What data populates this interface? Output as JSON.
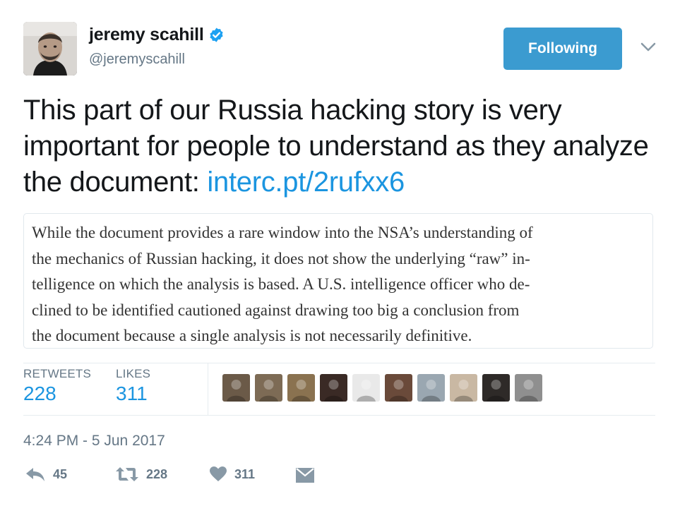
{
  "author": {
    "name": "jeremy scahill",
    "handle": "@jeremyscahill",
    "verified": true
  },
  "follow_button": {
    "label": "Following"
  },
  "tweet": {
    "text": "This part of our Russia hacking story is very important for people to understand as they analyze the document: ",
    "link": "interc.pt/2rufxx6"
  },
  "quote": {
    "text": "While the document provides a rare window into the NSA’s understanding of\nthe mechanics of Russian hacking, it does not show the underlying “raw” in-\ntelligence on which the analysis is based. A U.S. intelligence officer who de-\nclined to be identified cautioned against drawing too big a conclusion from\nthe document because a single analysis is not necessarily definitive."
  },
  "stats": {
    "retweets_label": "RETWEETS",
    "retweets_value": "228",
    "likes_label": "LIKES",
    "likes_value": "311"
  },
  "liker_avatars": [
    {
      "icon": "avatar-1",
      "color": "#6b5a48"
    },
    {
      "icon": "avatar-2",
      "color": "#7d6b55"
    },
    {
      "icon": "avatar-3",
      "color": "#8a7250"
    },
    {
      "icon": "avatar-4",
      "color": "#3a2a25"
    },
    {
      "icon": "avatar-5",
      "color": "#e9e9e9"
    },
    {
      "icon": "avatar-6",
      "color": "#6a4a3a"
    },
    {
      "icon": "avatar-7",
      "color": "#9aa7b1"
    },
    {
      "icon": "avatar-8",
      "color": "#c9b8a3"
    },
    {
      "icon": "avatar-9",
      "color": "#2e2a28"
    },
    {
      "icon": "avatar-10",
      "color": "#8f8f8f"
    }
  ],
  "timestamp": "4:24 PM - 5 Jun 2017",
  "actions": {
    "reply_count": "45",
    "retweet_count": "228",
    "like_count": "311"
  },
  "colors": {
    "accent": "#1b95e0",
    "follow_bg": "#3b9bd0",
    "muted": "#657786",
    "border": "#e1e8ed"
  }
}
